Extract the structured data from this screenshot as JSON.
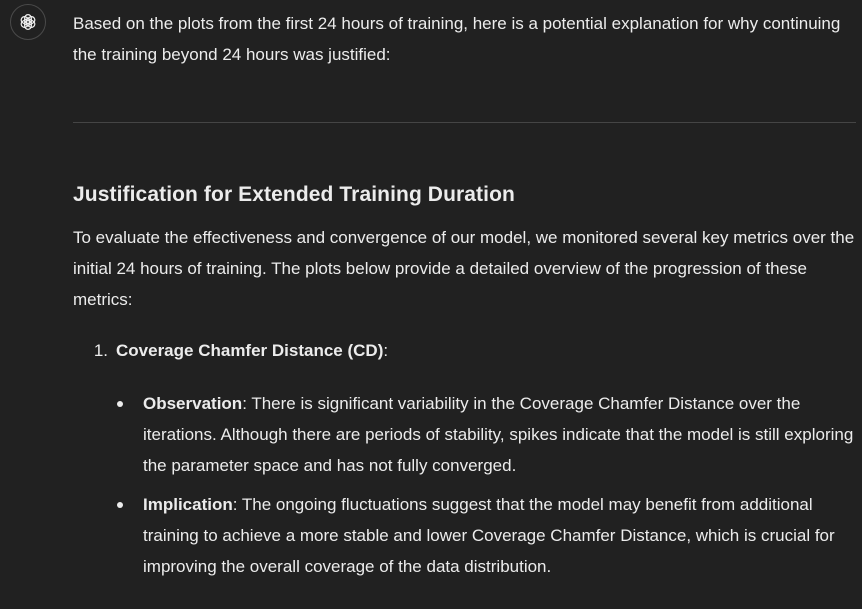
{
  "assistant": {
    "avatar_icon": "openai-logo-icon"
  },
  "intro": "Based on the plots from the first 24 hours of training, here is a potential explanation for why continuing the training beyond 24 hours was justified:",
  "section": {
    "title": "Justification for Extended Training Duration",
    "paragraph": "To evaluate the effectiveness and convergence of our model, we monitored several key metrics over the initial 24 hours of training. The plots below provide a detailed overview of the progression of these metrics:"
  },
  "list": {
    "item1": {
      "number": "1.",
      "label": "Coverage Chamfer Distance (CD)",
      "suffix": ":"
    }
  },
  "bullets": [
    {
      "term": "Observation",
      "text": ": There is significant variability in the Coverage Chamfer Distance over the iterations. Although there are periods of stability, spikes indicate that the model is still exploring the parameter space and has not fully converged."
    },
    {
      "term": "Implication",
      "text": ": The ongoing fluctuations suggest that the model may benefit from additional training to achieve a more stable and lower Coverage Chamfer Distance, which is crucial for improving the overall coverage of the data distribution."
    }
  ]
}
